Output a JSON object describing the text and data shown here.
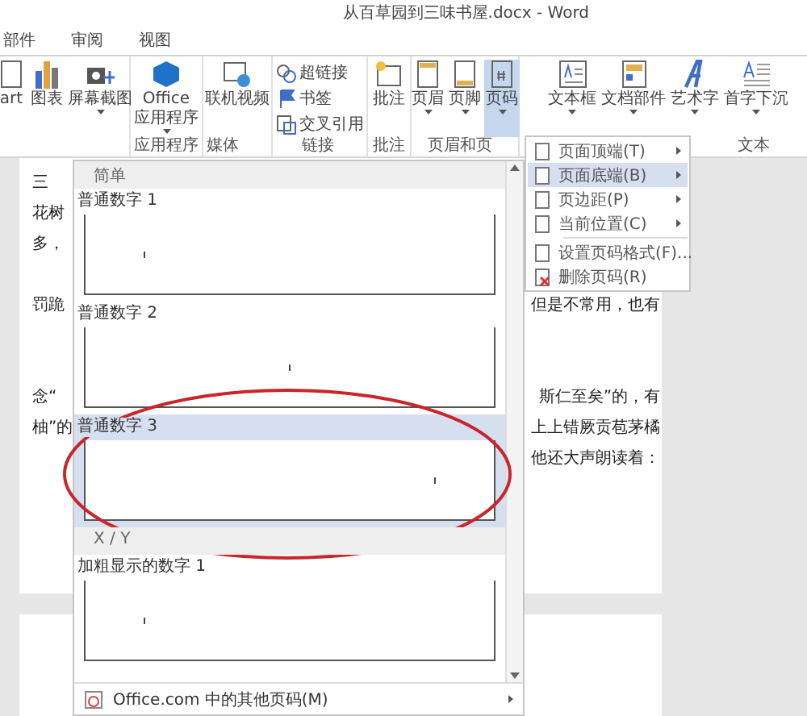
{
  "window": {
    "title": "从百草园到三味书屋.docx - Word"
  },
  "tabs": [
    {
      "label": "部件"
    },
    {
      "label": "审阅"
    },
    {
      "label": "视图"
    }
  ],
  "ribbon": {
    "groups": [
      {
        "buttons": [
          {
            "kind": "large",
            "label": "art",
            "dropdown": false,
            "selected": false
          },
          {
            "kind": "large",
            "label": "图表",
            "dropdown": false,
            "selected": false
          },
          {
            "kind": "large",
            "label": "屏幕截图",
            "dropdown": true,
            "selected": false
          }
        ]
      },
      {
        "label": "应用程序",
        "buttons": [
          {
            "kind": "large",
            "label": "Office",
            "label2": "应用程序",
            "dropdown": true,
            "selected": false
          }
        ]
      },
      {
        "label": "媒体",
        "buttons": [
          {
            "kind": "large",
            "label": "联机视频",
            "dropdown": false,
            "selected": false
          }
        ]
      },
      {
        "label": "链接",
        "buttons": [
          {
            "kind": "small",
            "label": "超链接"
          },
          {
            "kind": "small",
            "label": "书签"
          },
          {
            "kind": "small",
            "label": "交叉引用"
          }
        ]
      },
      {
        "label": "批注",
        "buttons": [
          {
            "kind": "large",
            "label": "批注",
            "dropdown": false,
            "selected": false
          }
        ]
      },
      {
        "label": "页眉和页",
        "buttons": [
          {
            "kind": "large",
            "label": "页眉",
            "dropdown": true,
            "selected": false
          },
          {
            "kind": "large",
            "label": "页脚",
            "dropdown": true,
            "selected": false
          },
          {
            "kind": "large",
            "label": "页码",
            "dropdown": true,
            "selected": true
          }
        ]
      },
      {
        "label": "文本",
        "buttons": [
          {
            "kind": "large",
            "label": "文本框",
            "dropdown": true,
            "selected": false
          },
          {
            "kind": "large",
            "label": "文档部件",
            "dropdown": true,
            "selected": false
          },
          {
            "kind": "large",
            "label": "艺术字",
            "dropdown": true,
            "selected": false
          },
          {
            "kind": "large",
            "label": "首字下沉",
            "dropdown": true,
            "selected": false
          }
        ]
      }
    ]
  },
  "document": {
    "lines": [
      {
        "kind": "text",
        "left": "三"
      },
      {
        "kind": "text",
        "left": "花树"
      },
      {
        "kind": "text",
        "left": "多，"
      },
      {
        "kind": "blank"
      },
      {
        "kind": "text",
        "left": "罚跪",
        "right": "但是不常用，也有"
      },
      {
        "kind": "blank"
      },
      {
        "kind": "blank"
      },
      {
        "kind": "text",
        "left": "念“",
        "right": "斯仁至矣”的，有"
      },
      {
        "kind": "text",
        "left": "柚”的",
        "right": "上上错厥贡苞茅橘"
      },
      {
        "kind": "text",
        "right": "他还大声朗读着："
      }
    ]
  },
  "gallery": {
    "sections": [
      {
        "title": "简单",
        "items": [
          {
            "label": "普通数字 1",
            "kind": "left",
            "selected": false
          },
          {
            "label": "普通数字 2",
            "kind": "center",
            "selected": false
          },
          {
            "label": "普通数字 3",
            "kind": "right",
            "selected": true
          }
        ]
      },
      {
        "title": "X / Y",
        "items": [
          {
            "label": "加粗显示的数字 1",
            "kind": "left",
            "selected": false
          }
        ]
      }
    ],
    "footer": {
      "label": "Office.com 中的其他页码(M)"
    }
  },
  "menu": {
    "items": [
      {
        "label": "页面顶端(T)",
        "submenu": true,
        "selected": false,
        "separator_before": false
      },
      {
        "label": "页面底端(B)",
        "submenu": true,
        "selected": true,
        "separator_before": false
      },
      {
        "label": "页边距(P)",
        "submenu": true,
        "selected": false,
        "separator_before": false
      },
      {
        "label": "当前位置(C)",
        "submenu": true,
        "selected": false,
        "separator_before": false
      },
      {
        "label": "设置页码格式(F)...",
        "submenu": false,
        "selected": false,
        "separator_before": true
      },
      {
        "label": "删除页码(R)",
        "submenu": false,
        "selected": false,
        "separator_before": false
      }
    ]
  }
}
